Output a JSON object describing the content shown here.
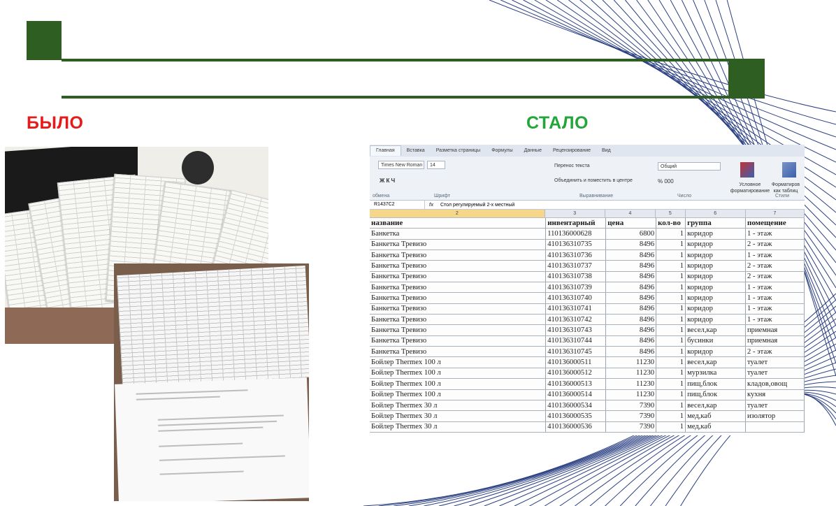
{
  "slide": {
    "before_label": "БЫЛО",
    "after_label": "СТАЛО",
    "colors": {
      "accent": "#2e5e22",
      "before": "#e51b1b",
      "after": "#22a63a"
    }
  },
  "excel": {
    "tabs": [
      "Главная",
      "Вставка",
      "Разметка страницы",
      "Формулы",
      "Данные",
      "Рецензирование",
      "Вид"
    ],
    "ribbon": {
      "font_name": "Times New Roman",
      "font_size": "14",
      "wrap_text": "Перенос текста",
      "merge_center": "Объединить и поместить в центре",
      "number_format": "Общий",
      "percent_group": "% 000",
      "bold_italic_underline": "Ж К Ч",
      "cond_format": "Условное форматирование",
      "table_format": "Форматиров как таблиц",
      "groups": [
        "обмена",
        "Шрифт",
        "Выравнивание",
        "Число",
        "Стили"
      ]
    },
    "name_box": "R1437C2",
    "formula": "Стол регулируемый 2-х местный",
    "col_numbers": [
      "2",
      "3",
      "4",
      "5",
      "6",
      "7"
    ],
    "headers": [
      "название",
      "инвентарный",
      "цена",
      "кол-во",
      "группа",
      "помещение"
    ],
    "rows": [
      [
        "Банкетка",
        "110136000628",
        "6800",
        "1",
        "коридор",
        "1 - этаж"
      ],
      [
        "Банкетка Тревизо",
        "410136310735",
        "8496",
        "1",
        "коридор",
        "2 - этаж"
      ],
      [
        "Банкетка Тревизо",
        "410136310736",
        "8496",
        "1",
        "коридор",
        "1 - этаж"
      ],
      [
        "Банкетка Тревизо",
        "410136310737",
        "8496",
        "1",
        "коридор",
        "2 - этаж"
      ],
      [
        "Банкетка Тревизо",
        "410136310738",
        "8496",
        "1",
        "коридор",
        "2 - этаж"
      ],
      [
        "Банкетка Тревизо",
        "410136310739",
        "8496",
        "1",
        "коридор",
        "1 - этаж"
      ],
      [
        "Банкетка Тревизо",
        "410136310740",
        "8496",
        "1",
        "коридор",
        "1 - этаж"
      ],
      [
        "Банкетка Тревизо",
        "410136310741",
        "8496",
        "1",
        "коридор",
        "1 - этаж"
      ],
      [
        "Банкетка Тревизо",
        "410136310742",
        "8496",
        "1",
        "коридор",
        "1 - этаж"
      ],
      [
        "Банкетка Тревизо",
        "410136310743",
        "8496",
        "1",
        "весел,кар",
        "приемная"
      ],
      [
        "Банкетка Тревизо",
        "410136310744",
        "8496",
        "1",
        "бусинки",
        "приемная"
      ],
      [
        "Банкетка Тревизо",
        "410136310745",
        "8496",
        "1",
        "коридор",
        "2 - этаж"
      ],
      [
        "Бойлер Thermex 100 л",
        "410136000511",
        "11230",
        "1",
        "весел,кар",
        "туалет"
      ],
      [
        "Бойлер Thermex 100 л",
        "410136000512",
        "11230",
        "1",
        "мурзилка",
        "туалет"
      ],
      [
        "Бойлер Thermex 100 л",
        "410136000513",
        "11230",
        "1",
        "пищ,блок",
        "кладов,овощ"
      ],
      [
        "Бойлер Thermex 100 л",
        "410136000514",
        "11230",
        "1",
        "пищ,блок",
        "кухня"
      ],
      [
        "Бойлер Thermex 30 л",
        "410136000534",
        "7390",
        "1",
        "весел,кар",
        "туалет"
      ],
      [
        "Бойлер Thermex 30 л",
        "410136000535",
        "7390",
        "1",
        "мед,каб",
        "изолятор"
      ],
      [
        "Бойлер Thermex 30 л",
        "410136000536",
        "7390",
        "1",
        "мед,каб",
        ""
      ]
    ]
  }
}
